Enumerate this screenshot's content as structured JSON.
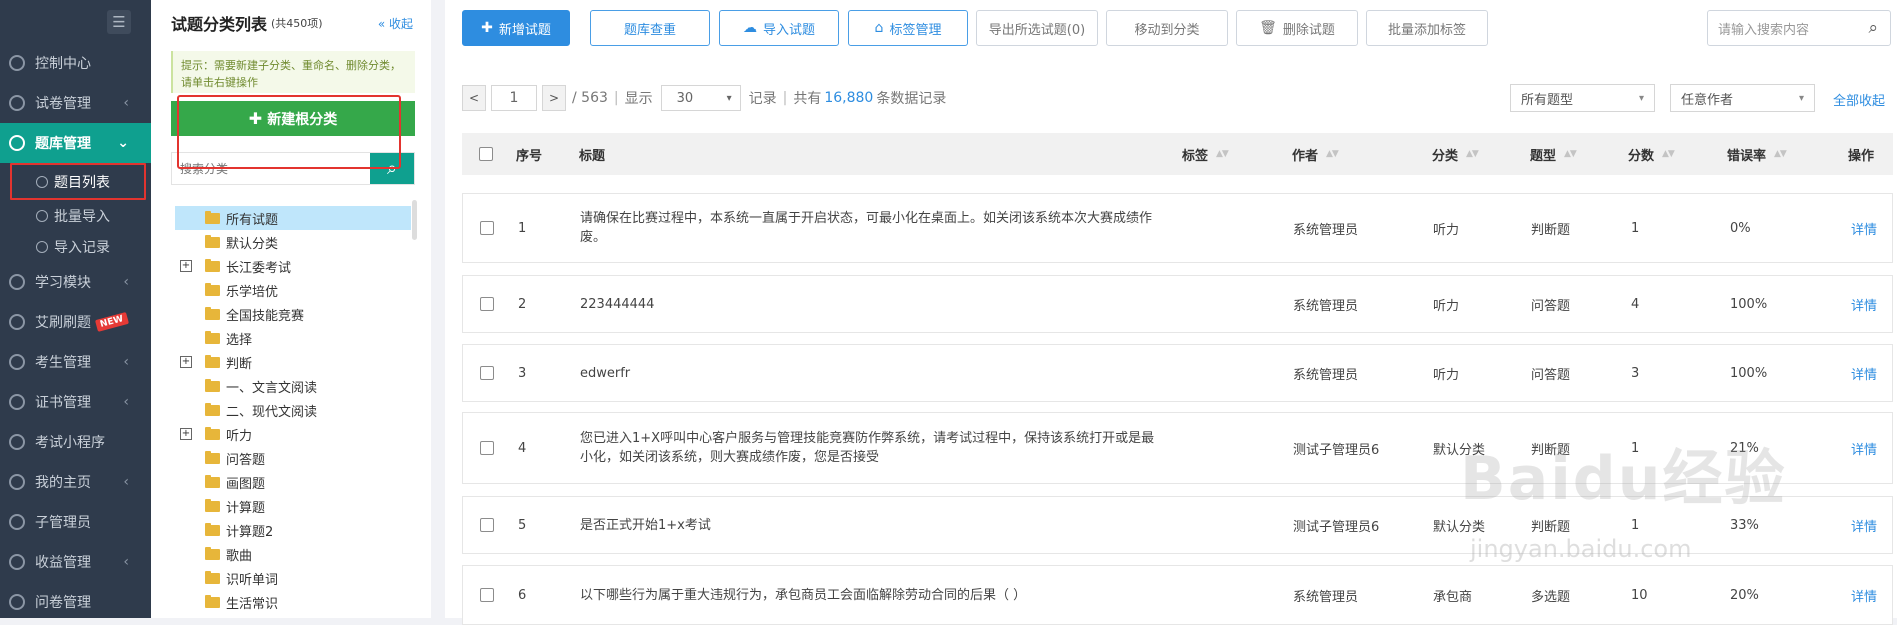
{
  "sidebar": {
    "menu_icon": "menu-icon",
    "items": [
      {
        "label": "控制中心",
        "chevron": false
      },
      {
        "label": "试卷管理",
        "chevron": true
      },
      {
        "label": "题库管理",
        "chevron": true,
        "active": true
      },
      {
        "label": "学习模块",
        "chevron": true
      },
      {
        "label": "艾刷刷题",
        "badge": "NEW"
      },
      {
        "label": "考生管理",
        "chevron": true
      },
      {
        "label": "证书管理",
        "chevron": true
      },
      {
        "label": "考试小程序"
      },
      {
        "label": "我的主页",
        "chevron": true
      },
      {
        "label": "子管理员"
      },
      {
        "label": "收益管理",
        "chevron": true
      },
      {
        "label": "问卷管理"
      }
    ],
    "subitems": [
      {
        "label": "题目列表",
        "selected": true
      },
      {
        "label": "批量导入"
      },
      {
        "label": "导入记录"
      }
    ]
  },
  "tree": {
    "title": "试题分类列表",
    "count": "(共450项)",
    "collapse": "收起",
    "tip": "提示：需要新建子分类、重命名、删除分类，请单击右键操作",
    "new_root": "新建根分类",
    "search_placeholder": "搜索分类",
    "nodes": [
      {
        "label": "所有试题",
        "selected": true
      },
      {
        "label": "默认分类"
      },
      {
        "label": "长江委考试",
        "expandable": true
      },
      {
        "label": "乐学培优"
      },
      {
        "label": "全国技能竞赛"
      },
      {
        "label": "选择"
      },
      {
        "label": "判断",
        "expandable": true
      },
      {
        "label": "一、文言文阅读"
      },
      {
        "label": "二、现代文阅读"
      },
      {
        "label": "听力",
        "expandable": true
      },
      {
        "label": "问答题"
      },
      {
        "label": "画图题"
      },
      {
        "label": "计算题"
      },
      {
        "label": "计算题2"
      },
      {
        "label": "歌曲"
      },
      {
        "label": "识听单词"
      },
      {
        "label": "生活常识"
      }
    ]
  },
  "toolbar": {
    "add": "新增试题",
    "dedupe": "题库查重",
    "import": "导入试题",
    "tags": "标签管理",
    "export": "导出所选试题(0)",
    "move": "移动到分类",
    "delete": "删除试题",
    "batch_tag": "批量添加标签",
    "search_placeholder": "请输入搜索内容"
  },
  "pager": {
    "page": "1",
    "total_pages": "/ 563",
    "sep1": "|",
    "show": "显示",
    "per_page": "30",
    "records": "记录",
    "sep2": "|",
    "total_prefix": "共有",
    "total": "16,880",
    "total_suffix": "条数据记录"
  },
  "filters": {
    "type": "所有题型",
    "author": "任意作者",
    "collapse_all": "全部收起"
  },
  "table": {
    "headers": {
      "no": "序号",
      "title": "标题",
      "tag": "标签",
      "author": "作者",
      "category": "分类",
      "type": "题型",
      "score": "分数",
      "error_rate": "错误率",
      "op": "操作"
    },
    "rows": [
      {
        "no": "1",
        "title": "请确保在比赛过程中，本系统一直属于开启状态，可最小化在桌面上。如关闭该系统本次大赛成绩作废。",
        "author": "系统管理员",
        "category": "听力",
        "type": "判断题",
        "score": "1",
        "error_rate": "0%",
        "op": "详情"
      },
      {
        "no": "2",
        "title": "223444444",
        "author": "系统管理员",
        "category": "听力",
        "type": "问答题",
        "score": "4",
        "error_rate": "100%",
        "op": "详情"
      },
      {
        "no": "3",
        "title": "edwerfr",
        "author": "系统管理员",
        "category": "听力",
        "type": "问答题",
        "score": "3",
        "error_rate": "100%",
        "op": "详情"
      },
      {
        "no": "4",
        "title": "您已进入1+X呼叫中心客户服务与管理技能竞赛防作弊系统，请考试过程中，保持该系统打开或是最小化，如关闭该系统，则大赛成绩作废，您是否接受",
        "author": "测试子管理员6",
        "category": "默认分类",
        "type": "判断题",
        "score": "1",
        "error_rate": "21%",
        "op": "详情"
      },
      {
        "no": "5",
        "title": "是否正式开始1+x考试",
        "author": "测试子管理员6",
        "category": "默认分类",
        "type": "判断题",
        "score": "1",
        "error_rate": "33%",
        "op": "详情"
      },
      {
        "no": "6",
        "title": "以下哪些行为属于重大违规行为，承包商员工会面临解除劳动合同的后果（ ）",
        "author": "系统管理员",
        "category": "承包商",
        "type": "多选题",
        "score": "10",
        "error_rate": "20%",
        "op": "详情"
      }
    ]
  },
  "watermark": {
    "line1": "Baidu经验",
    "line2": "jingyan.baidu.com"
  }
}
